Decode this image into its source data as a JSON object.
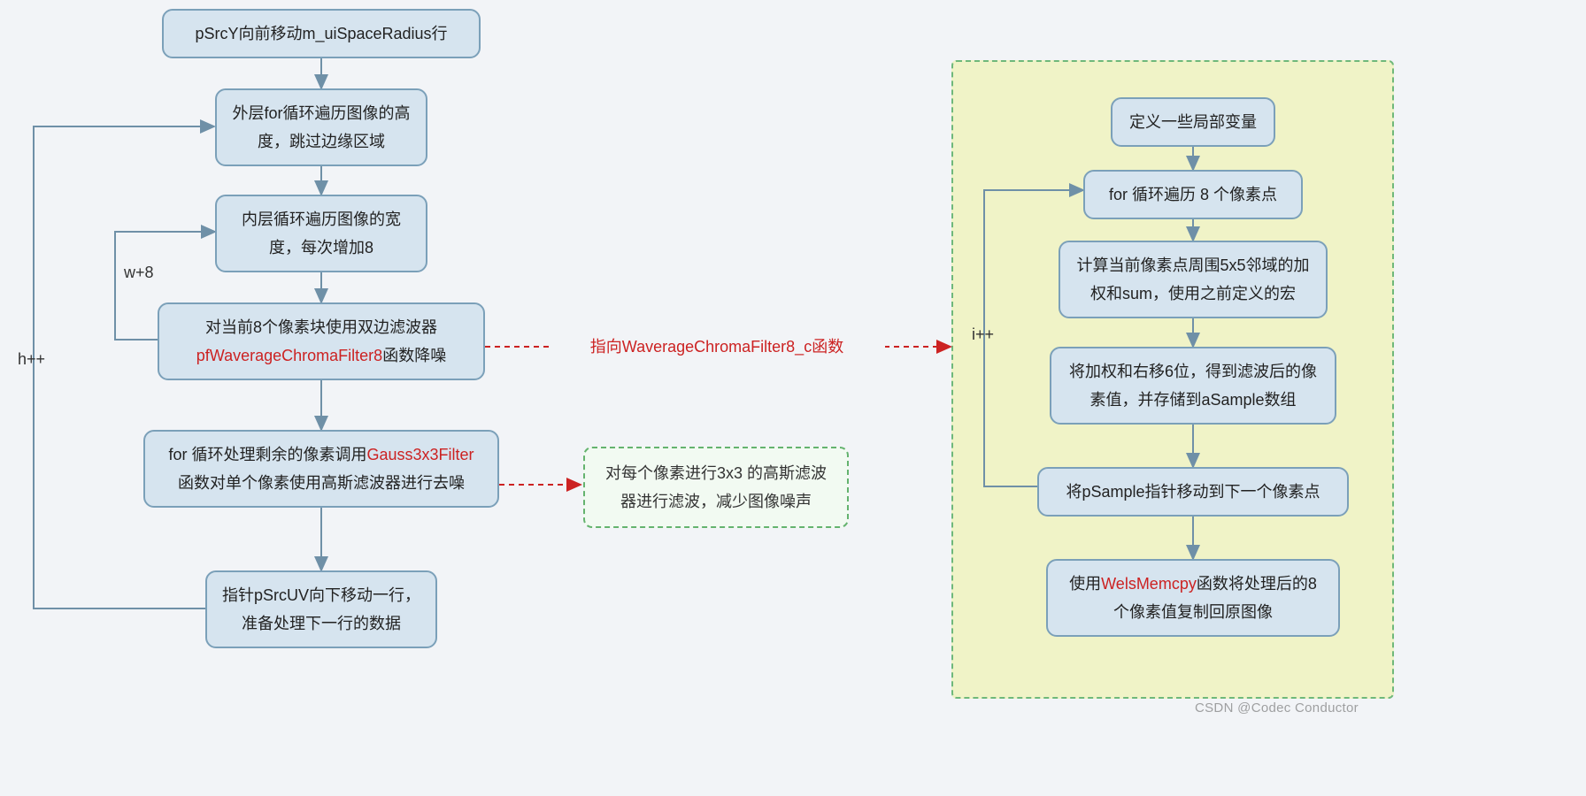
{
  "left": {
    "n1": "pSrcY向前移动m_uiSpaceRadius行",
    "n2": "外层for循环遍历图像的高度，跳过边缘区域",
    "n3": "内层循环遍历图像的宽度，每次增加8",
    "n4_a": "对当前8个像素块使用双边滤波器",
    "n4_b": "pfWaverageChromaFilter8",
    "n4_c": "函数降噪",
    "n5_a": "for 循环处理剩余的像素调用",
    "n5_b": "Gauss3x3Filter",
    "n5_c": "函数对单个像素使用高斯滤波器进行去噪",
    "n6": "指针pSrcUV向下移动一行，准备处理下一行的数据",
    "loop_outer": "h++",
    "loop_inner": "w+8"
  },
  "center": {
    "ptr_label": "指向WaverageChromaFilter8_c函数",
    "gauss": "对每个像素进行3x3 的高斯滤波器进行滤波，减少图像噪声"
  },
  "right": {
    "r1": "定义一些局部变量",
    "r2": "for 循环遍历 8 个像素点",
    "r3": "计算当前像素点周围5x5邻域的加权和sum，使用之前定义的宏",
    "r4": "将加权和右移6位，得到滤波后的像素值，并存储到aSample数组",
    "r5": "将pSample指针移动到下一个像素点",
    "r6_a": "使用",
    "r6_b": "WelsMemcpy",
    "r6_c": "函数将处理后的8个像素值复制回原图像",
    "loop": "i++"
  },
  "watermark": "CSDN @Codec Conductor"
}
